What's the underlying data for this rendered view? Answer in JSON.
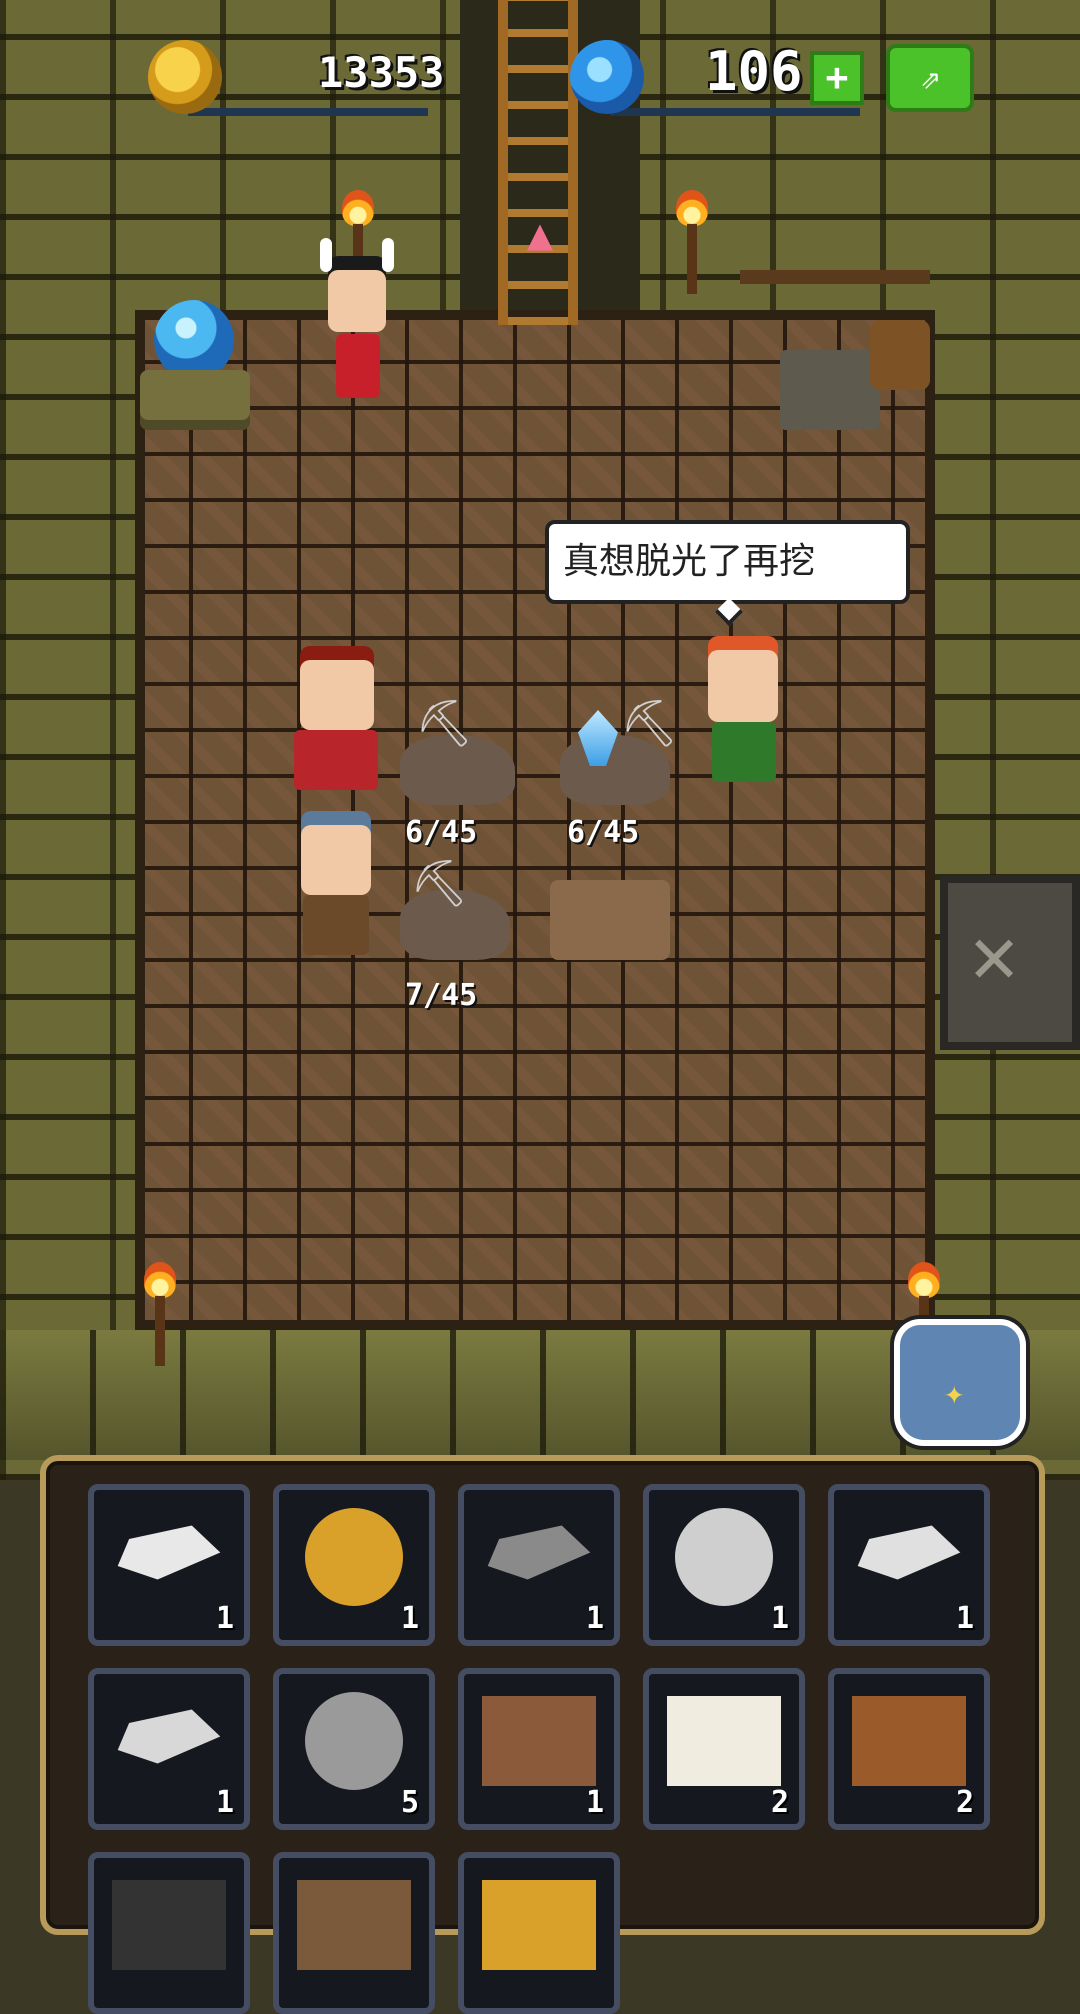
{
  "hud": {
    "gold_amount": "13353",
    "gem_amount": "106",
    "add_button_label": "+",
    "share_button_label": "⇗"
  },
  "scene": {
    "speech_text": "真想脱光了再挖",
    "mining_progress": [
      {
        "label": "6/45"
      },
      {
        "label": "6/45"
      },
      {
        "label": "7/45"
      }
    ]
  },
  "inventory": {
    "slots": [
      {
        "icon": "silver-ingot-icon",
        "count": "1",
        "color": "#e8e8e8"
      },
      {
        "icon": "gold-coin-icon",
        "count": "1",
        "color": "#d9a12a"
      },
      {
        "icon": "iron-ingot-icon",
        "count": "1",
        "color": "#8a8a8a"
      },
      {
        "icon": "silver-coin-icon",
        "count": "1",
        "color": "#cfcfcf"
      },
      {
        "icon": "silver-bar-icon",
        "count": "1",
        "color": "#e0e0e0"
      },
      {
        "icon": "silver-ore-icon",
        "count": "1",
        "color": "#d8d8d8"
      },
      {
        "icon": "stone-icon",
        "count": "5",
        "color": "#9a9a9a"
      },
      {
        "icon": "clay-icon",
        "count": "1",
        "color": "#8a5a3a"
      },
      {
        "icon": "bone-icon",
        "count": "2",
        "color": "#f0ece0"
      },
      {
        "icon": "wood-log-icon",
        "count": "2",
        "color": "#9a5a2a"
      },
      {
        "icon": "coal-icon",
        "count": "",
        "color": "#333333"
      },
      {
        "icon": "ore-icon",
        "count": "",
        "color": "#7a5a3a"
      },
      {
        "icon": "gold-nugget-icon",
        "count": "",
        "color": "#d9a12a"
      }
    ]
  }
}
